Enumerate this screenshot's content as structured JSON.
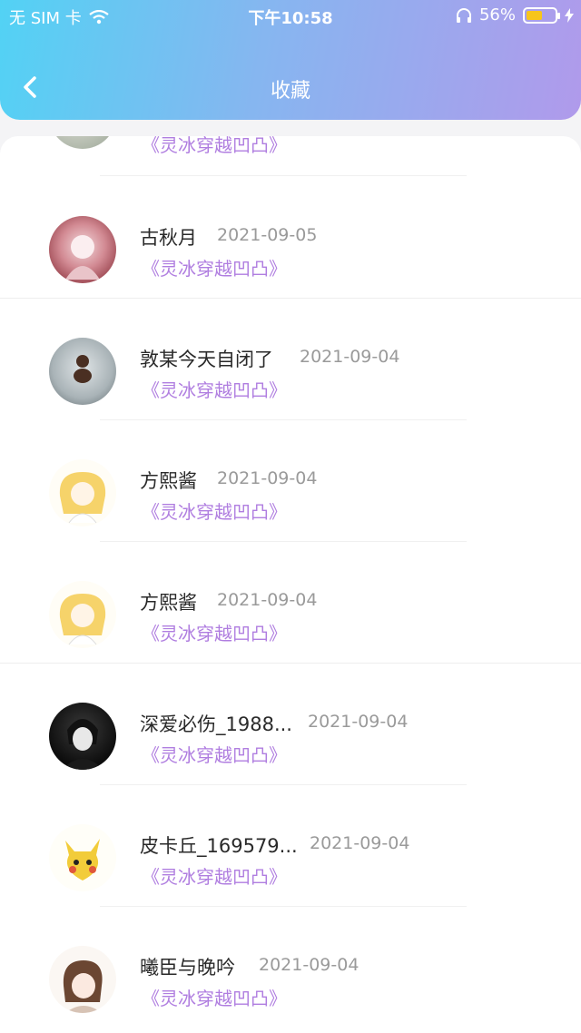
{
  "status_bar": {
    "carrier": "无 SIM 卡",
    "time": "下午10:58",
    "battery": "56%"
  },
  "nav": {
    "title": "收藏"
  },
  "items": [
    {
      "name": "",
      "date": "",
      "work": "《灵冰穿越凹凸》"
    },
    {
      "name": "古秋月",
      "date": "2021-09-05",
      "work": "《灵冰穿越凹凸》"
    },
    {
      "name": "敦某今天自闭了",
      "date": "2021-09-04",
      "work": "《灵冰穿越凹凸》"
    },
    {
      "name": "方熙酱",
      "date": "2021-09-04",
      "work": "《灵冰穿越凹凸》"
    },
    {
      "name": "方熙酱",
      "date": "2021-09-04",
      "work": "《灵冰穿越凹凸》"
    },
    {
      "name": "深爱必伤_1988...",
      "date": "2021-09-04",
      "work": "《灵冰穿越凹凸》"
    },
    {
      "name": "皮卡丘_169579...",
      "date": "2021-09-04",
      "work": "《灵冰穿越凹凸》"
    },
    {
      "name": "曦臣与晚吟",
      "date": "2021-09-04",
      "work": "《灵冰穿越凹凸》"
    }
  ]
}
